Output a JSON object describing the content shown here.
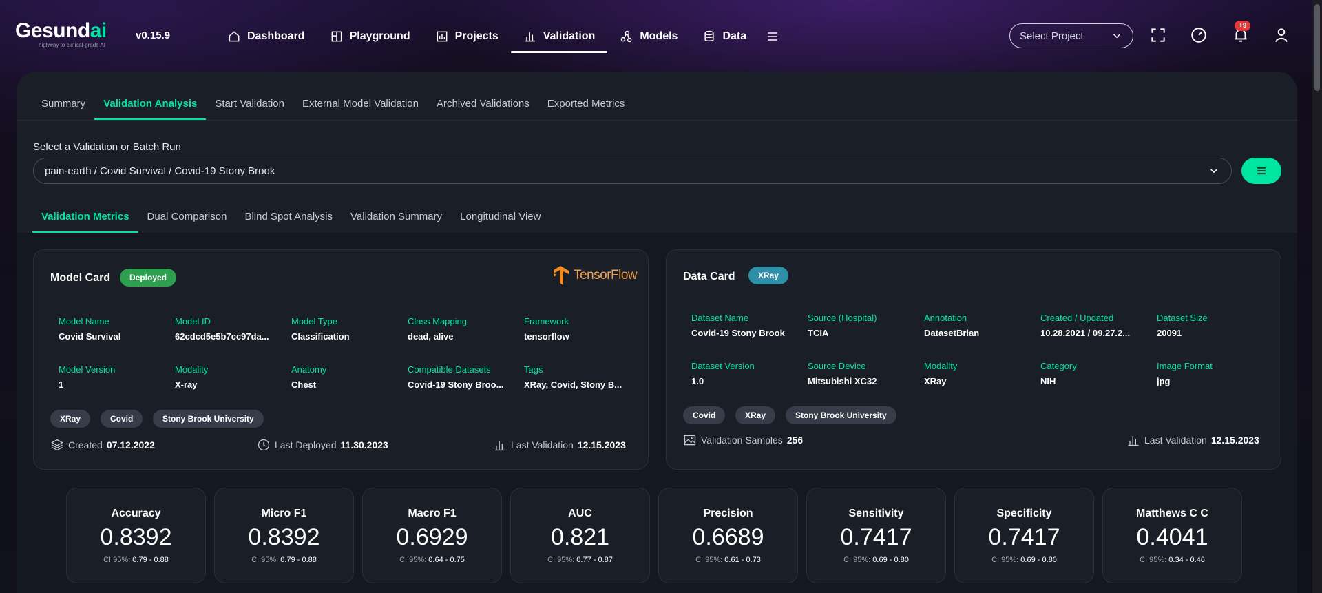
{
  "brand": {
    "logo_main": "Gesund",
    "logo_ai": "ai",
    "tagline": "highway to clinical-grade AI",
    "version": "v0.15.9"
  },
  "nav": {
    "items": [
      {
        "label": "Dashboard",
        "icon": "home-icon"
      },
      {
        "label": "Playground",
        "icon": "playground-icon"
      },
      {
        "label": "Projects",
        "icon": "projects-icon"
      },
      {
        "label": "Validation",
        "icon": "bar-chart-icon",
        "active": true
      },
      {
        "label": "Models",
        "icon": "models-icon"
      },
      {
        "label": "Data",
        "icon": "database-icon"
      }
    ],
    "select_project_placeholder": "Select Project",
    "notification_count": "+9"
  },
  "tabs_primary": [
    "Summary",
    "Validation Analysis",
    "Start Validation",
    "External Model Validation",
    "Archived Validations",
    "Exported Metrics"
  ],
  "selector": {
    "label": "Select a Validation or Batch Run",
    "value": "pain-earth / Covid Survival / Covid-19 Stony Brook"
  },
  "tabs_secondary": [
    "Validation Metrics",
    "Dual Comparison",
    "Blind Spot Analysis",
    "Validation Summary",
    "Longitudinal View"
  ],
  "model_card": {
    "title": "Model Card",
    "status": "Deployed",
    "framework_logo": "TensorFlow",
    "fields": [
      {
        "label": "Model Name",
        "value": "Covid Survival"
      },
      {
        "label": "Model ID",
        "value": "62cdcd5e5b7cc97da..."
      },
      {
        "label": "Model Type",
        "value": "Classification"
      },
      {
        "label": "Class Mapping",
        "value": "dead, alive"
      },
      {
        "label": "Framework",
        "value": "tensorflow"
      },
      {
        "label": "Model Version",
        "value": "1"
      },
      {
        "label": "Modality",
        "value": "X-ray"
      },
      {
        "label": "Anatomy",
        "value": "Chest"
      },
      {
        "label": "Compatible Datasets",
        "value": "Covid-19 Stony Broo..."
      },
      {
        "label": "Tags",
        "value": "XRay, Covid, Stony B..."
      }
    ],
    "tags": [
      "XRay",
      "Covid",
      "Stony Brook University"
    ],
    "created_label": "Created",
    "created": "07.12.2022",
    "deployed_label": "Last Deployed",
    "deployed": "11.30.2023",
    "validation_label": "Last Validation",
    "validation": "12.15.2023"
  },
  "data_card": {
    "title": "Data Card",
    "badge": "XRay",
    "fields": [
      {
        "label": "Dataset Name",
        "value": "Covid-19 Stony Brook"
      },
      {
        "label": "Source (Hospital)",
        "value": "TCIA"
      },
      {
        "label": "Annotation",
        "value": "DatasetBrian"
      },
      {
        "label": "Created / Updated",
        "value": "10.28.2021 / 09.27.2..."
      },
      {
        "label": "Dataset Size",
        "value": "20091"
      },
      {
        "label": "Dataset Version",
        "value": "1.0"
      },
      {
        "label": "Source Device",
        "value": "Mitsubishi XC32"
      },
      {
        "label": "Modality",
        "value": "XRay"
      },
      {
        "label": "Category",
        "value": "NIH"
      },
      {
        "label": "Image Format",
        "value": "jpg"
      }
    ],
    "tags": [
      "Covid",
      "XRay",
      "Stony Brook University"
    ],
    "samples_label": "Validation Samples",
    "samples": "256",
    "validation_label": "Last Validation",
    "validation": "12.15.2023"
  },
  "metrics": [
    {
      "name": "Accuracy",
      "value": "0.8392",
      "ci_label": "CI 95%:",
      "ci": "0.79 - 0.88"
    },
    {
      "name": "Micro F1",
      "value": "0.8392",
      "ci_label": "CI 95%:",
      "ci": "0.79 - 0.88"
    },
    {
      "name": "Macro F1",
      "value": "0.6929",
      "ci_label": "CI 95%:",
      "ci": "0.64 - 0.75"
    },
    {
      "name": "AUC",
      "value": "0.821",
      "ci_label": "CI 95%:",
      "ci": "0.77 - 0.87"
    },
    {
      "name": "Precision",
      "value": "0.6689",
      "ci_label": "CI 95%:",
      "ci": "0.61 - 0.73"
    },
    {
      "name": "Sensitivity",
      "value": "0.7417",
      "ci_label": "CI 95%:",
      "ci": "0.69 - 0.80"
    },
    {
      "name": "Specificity",
      "value": "0.7417",
      "ci_label": "CI 95%:",
      "ci": "0.69 - 0.80"
    },
    {
      "name": "Matthews C C",
      "value": "0.4041",
      "ci_label": "CI 95%:",
      "ci": "0.34 - 0.46"
    }
  ],
  "colors": {
    "accent": "#00e5a0",
    "deployed": "#2e9e4f",
    "xray_badge": "#2f8fa8",
    "notif": "#e53b3b"
  }
}
